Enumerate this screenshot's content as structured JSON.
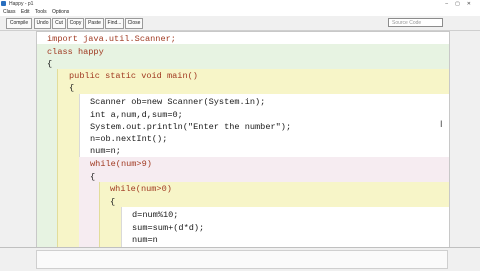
{
  "window": {
    "title": "Happy - p1"
  },
  "menu": [
    "Class",
    "Edit",
    "Tools",
    "Options"
  ],
  "toolbar": {
    "buttons": [
      "Compile",
      "Undo",
      "Cut",
      "Copy",
      "Paste",
      "Find...",
      "Close"
    ],
    "source_select": "Source Code"
  },
  "code": {
    "lines": [
      "import java.util.Scanner;",
      "class happy",
      "{",
      "public static void main()",
      "{",
      "Scanner ob=new Scanner(System.in);",
      "int a,num,d,sum=0;",
      "System.out.println(\"Enter the number\");",
      "n=ob.nextInt();",
      "num=n;",
      "while(num>9)",
      "{",
      "while(num>0)",
      "{",
      "d=num%10;",
      "sum=sum+(d*d);",
      "num=n"
    ]
  },
  "colors": {
    "class_scope": "#e7f3e2",
    "method_scope": "#f7f5c8",
    "body_scope": "#ffffff",
    "loop_scope": "#f6ecf1",
    "keyword": "#a03a22"
  }
}
